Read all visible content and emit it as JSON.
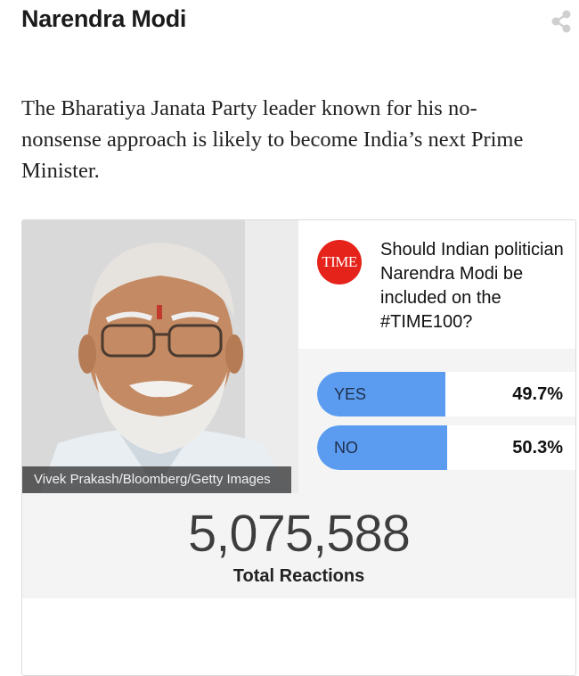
{
  "article": {
    "title": "Narendra Modi",
    "description": "The Bharatiya Janata Party leader known for his no-nonsense approach is likely to become India’s next Prime Minister."
  },
  "icons": {
    "share": "share-icon"
  },
  "poll": {
    "photo_credit": "Vivek Prakash/Bloomberg/Getty Images",
    "logo_text": "TIME",
    "question": "Should Indian politician Narendra Modi be included on the #TIME100?",
    "options": [
      {
        "label": "YES",
        "percent_text": "49.7%",
        "percent": 49.7
      },
      {
        "label": "NO",
        "percent_text": "50.3%",
        "percent": 50.3
      }
    ],
    "total_reactions": "5,075,588",
    "total_label": "Total Reactions"
  },
  "colors": {
    "accent_blue": "#5b9cf0",
    "time_red": "#e5231b"
  }
}
